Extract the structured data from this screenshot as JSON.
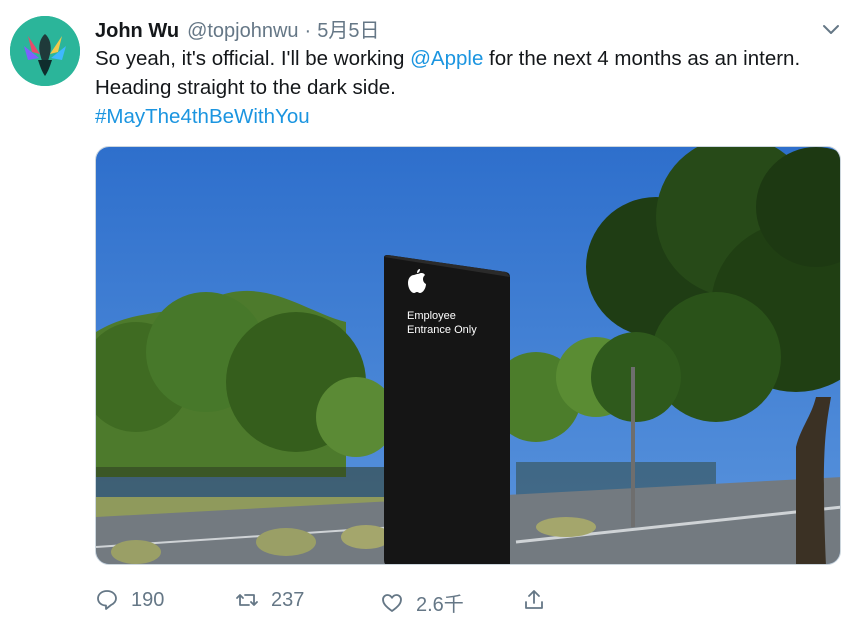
{
  "tweet": {
    "author_name": "John Wu",
    "author_handle": "@topjohnwu",
    "separator": "·",
    "date": "5月5日",
    "text_before_mention": "So yeah, it's official. I'll be working ",
    "mention": "@Apple",
    "text_after_mention": " for the next 4 months as an intern. Heading straight to the dark side.",
    "hashtag": "#MayThe4thBeWithYou",
    "media": {
      "sign_line1": "Employee",
      "sign_line2": "Entrance Only"
    }
  },
  "actions": {
    "reply_count": "190",
    "retweet_count": "237",
    "like_count": "2.6千"
  },
  "colors": {
    "link": "#1b95e0",
    "muted": "#657786",
    "avatar_bg": "#2bb59a"
  },
  "icons": [
    "magisk-avatar",
    "chevron-down-icon",
    "reply-icon",
    "retweet-icon",
    "like-icon",
    "share-icon"
  ]
}
